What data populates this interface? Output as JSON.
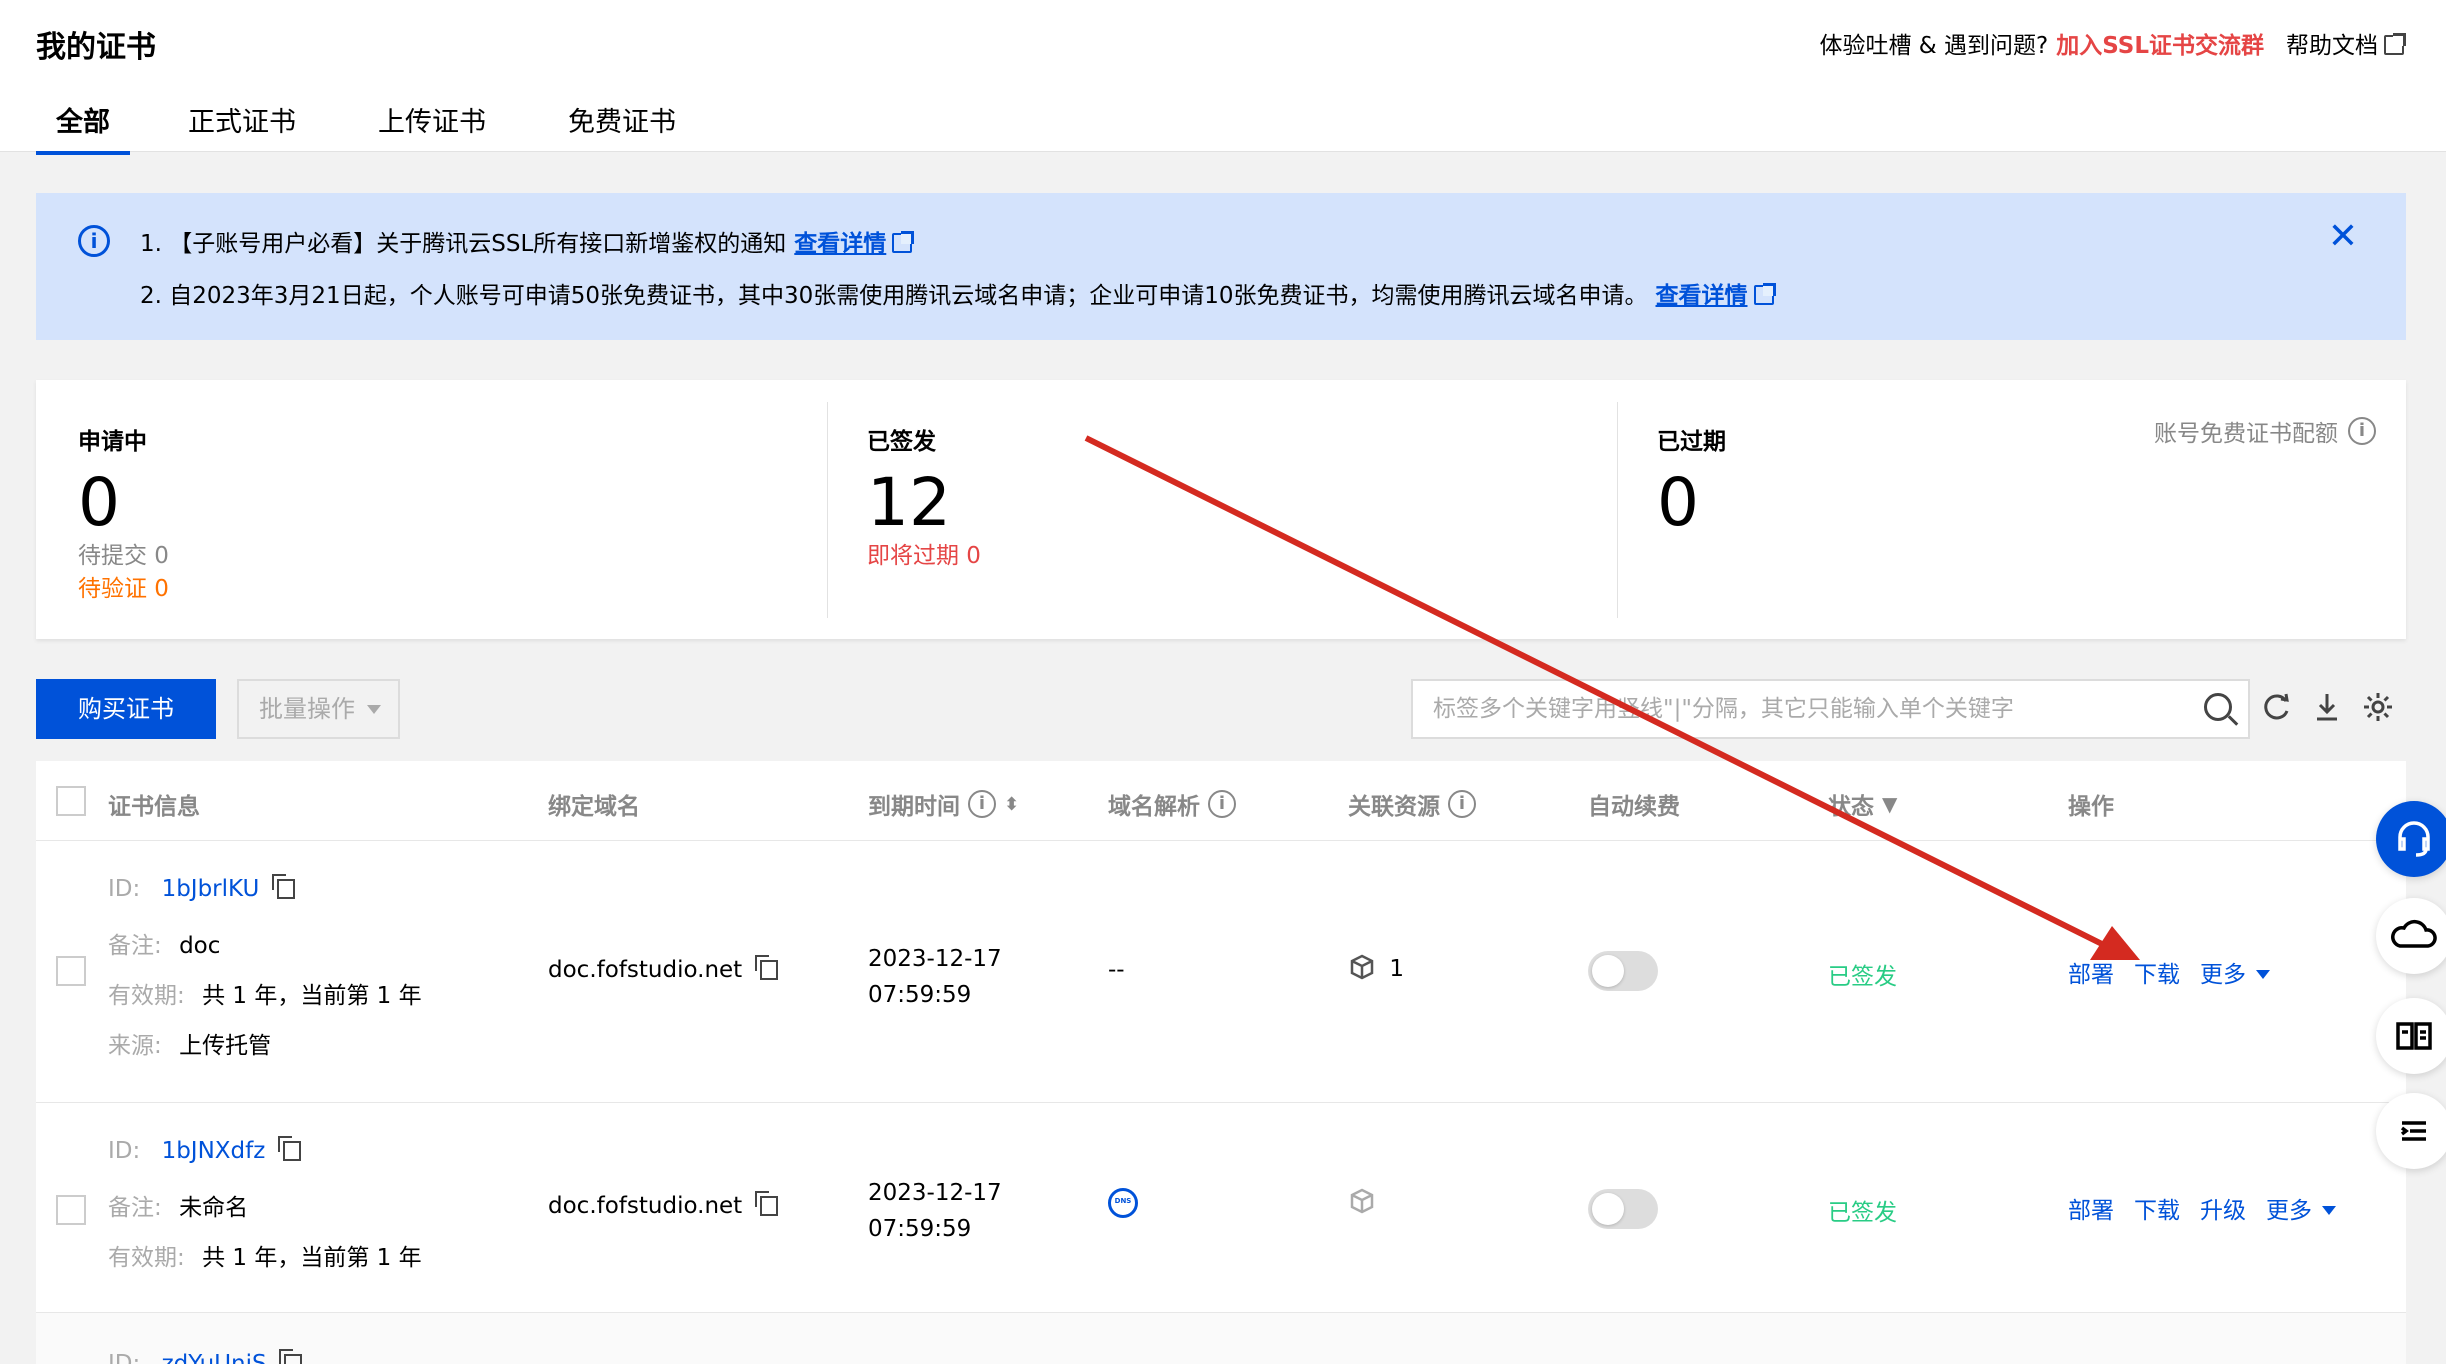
{
  "header": {
    "title": "我的证书",
    "feedback_text": "体验吐槽 & 遇到问题?",
    "join_group": "加入SSL证书交流群",
    "help_docs": "帮助文档"
  },
  "tabs": [
    {
      "label": "全部",
      "active": true
    },
    {
      "label": "正式证书"
    },
    {
      "label": "上传证书"
    },
    {
      "label": "免费证书"
    }
  ],
  "notice": {
    "line1_text": "1. 【子账号用户必看】关于腾讯云SSL所有接口新增鉴权的通知",
    "line1_link": "查看详情",
    "line2_text": "2. 自2023年3月21日起，个人账号可申请50张免费证书，其中30张需使用腾讯云域名申请；企业可申请10张免费证书，均需使用腾讯云域名申请。",
    "line2_link": "查看详情"
  },
  "stats": {
    "applying": {
      "label": "申请中",
      "value": "0",
      "pending_submit": "待提交 0",
      "pending_verify": "待验证 0"
    },
    "issued": {
      "label": "已签发",
      "value": "12",
      "expiring": "即将过期 0"
    },
    "expired": {
      "label": "已过期",
      "value": "0"
    },
    "quota_label": "账号免费证书配额"
  },
  "toolbar": {
    "buy_label": "购买证书",
    "batch_label": "批量操作",
    "search_placeholder": "标签多个关键字用竖线\"|\"分隔，其它只能输入单个关键字"
  },
  "table": {
    "columns": [
      "证书信息",
      "绑定域名",
      "到期时间",
      "域名解析",
      "关联资源",
      "自动续费",
      "状态",
      "操作"
    ],
    "rows": [
      {
        "id_label": "ID:",
        "id": "1bJbrlKU",
        "note_label": "备注:",
        "note": "doc",
        "validity_label": "有效期:",
        "validity": "共 1 年，当前第 1 年",
        "source_label": "来源:",
        "source": "上传托管",
        "domain": "doc.fofstudio.net",
        "expire_date": "2023-12-17",
        "expire_time": "07:59:59",
        "dns": "--",
        "resources": "1",
        "status": "已签发",
        "actions": [
          "部署",
          "下载",
          "更多"
        ]
      },
      {
        "id_label": "ID:",
        "id": "1bJNXdfz",
        "note_label": "备注:",
        "note": "未命名",
        "validity_label": "有效期:",
        "validity": "共 1 年，当前第 1 年",
        "domain": "doc.fofstudio.net",
        "expire_date": "2023-12-17",
        "expire_time": "07:59:59",
        "status": "已签发",
        "actions": [
          "部署",
          "下载",
          "升级",
          "更多"
        ]
      },
      {
        "id_label": "ID:",
        "id": "zdYuUniS"
      }
    ]
  },
  "colors": {
    "primary": "#0052d9",
    "danger": "#e54545",
    "warning": "#ff7200",
    "success": "#29cc85",
    "annotation_arrow": "#d42a20"
  }
}
